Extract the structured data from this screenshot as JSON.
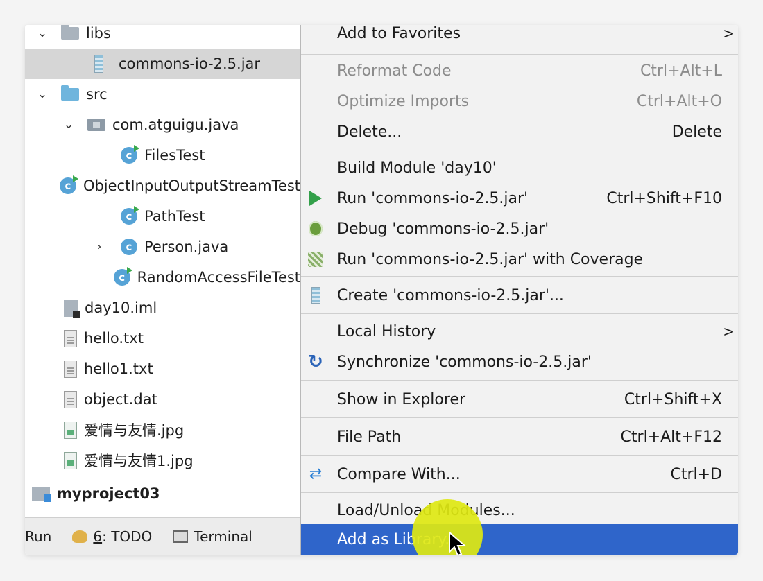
{
  "tree": {
    "rows": [
      {
        "label": "libs",
        "expanded": true,
        "icon": "folder-icon"
      },
      {
        "label": "commons-io-2.5.jar",
        "icon": "jar-icon",
        "selected": true
      },
      {
        "label": "src",
        "expanded": true,
        "icon": "source-folder-icon"
      },
      {
        "label": "com.atguigu.java",
        "expanded": true,
        "icon": "package-icon"
      },
      {
        "label": "FilesTest",
        "icon": "java-class-icon",
        "class_letter": "c"
      },
      {
        "label": "ObjectInputOutputStreamTest",
        "icon": "java-class-icon",
        "class_letter": "c"
      },
      {
        "label": "PathTest",
        "icon": "java-class-icon",
        "class_letter": "c"
      },
      {
        "label": "Person.java",
        "expandable": true,
        "icon": "java-class-icon",
        "class_letter": "c"
      },
      {
        "label": "RandomAccessFileTest",
        "icon": "java-class-icon",
        "class_letter": "c"
      },
      {
        "label": "day10.iml",
        "icon": "iml-file-icon"
      },
      {
        "label": "hello.txt",
        "icon": "text-file-icon"
      },
      {
        "label": "hello1.txt",
        "icon": "text-file-icon"
      },
      {
        "label": "object.dat",
        "icon": "text-file-icon"
      },
      {
        "label": "爱情与友情.jpg",
        "icon": "image-file-icon"
      },
      {
        "label": "爱情与友情1.jpg",
        "icon": "image-file-icon"
      },
      {
        "label": "myproject03",
        "icon": "module-icon",
        "bold": true
      }
    ],
    "expanded_glyph": "❯",
    "collapsed_glyph": "›"
  },
  "bottom_bar": {
    "run": "Run",
    "todo_num": "6",
    "todo_label": ": TODO",
    "terminal": "Terminal"
  },
  "menu": {
    "items": [
      {
        "label": "Add to Favorites",
        "submenu": true
      },
      {
        "label": "Reformat Code",
        "shortcut": "Ctrl+Alt+L",
        "disabled": true
      },
      {
        "label": "Optimize Imports",
        "shortcut": "Ctrl+Alt+O",
        "disabled": true
      },
      {
        "label": "Delete...",
        "shortcut": "Delete"
      },
      {
        "label": "Build Module 'day10'"
      },
      {
        "label": "Run 'commons-io-2.5.jar'",
        "shortcut": "Ctrl+Shift+F10",
        "icon": "run-icon"
      },
      {
        "label": "Debug 'commons-io-2.5.jar'",
        "icon": "debug-icon"
      },
      {
        "label": "Run 'commons-io-2.5.jar' with Coverage",
        "icon": "coverage-icon"
      },
      {
        "label": "Create 'commons-io-2.5.jar'...",
        "icon": "jar-icon"
      },
      {
        "label": "Local History",
        "submenu": true
      },
      {
        "label": "Synchronize 'commons-io-2.5.jar'",
        "icon": "sync-icon"
      },
      {
        "label": "Show in Explorer",
        "shortcut": "Ctrl+Shift+X"
      },
      {
        "label": "File Path",
        "shortcut": "Ctrl+Alt+F12"
      },
      {
        "label": "Compare With...",
        "shortcut": "Ctrl+D",
        "icon": "compare-icon"
      },
      {
        "label": "Load/Unload Modules..."
      },
      {
        "label": "Add as Library...",
        "highlighted": true
      }
    ],
    "submenu_glyph": ">"
  },
  "colors": {
    "menu_highlight": "#2f65ca",
    "selected_row": "#d6d6d6",
    "cursor_spotlight": "#dee812"
  }
}
